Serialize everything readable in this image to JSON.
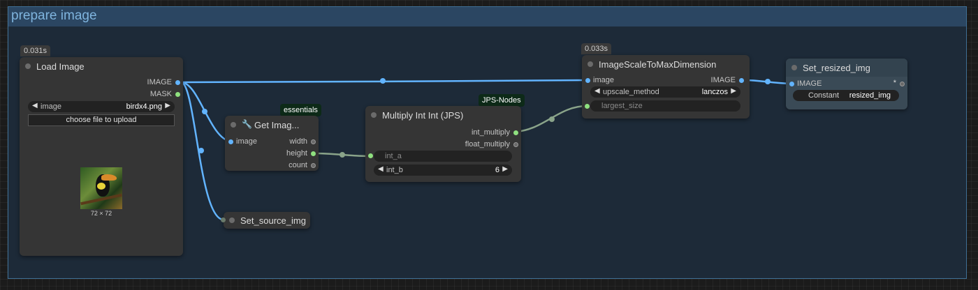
{
  "group": {
    "title": "prepare image"
  },
  "colors": {
    "image_link": "#62b4ff",
    "int_link": "#8aa48a",
    "group_header": "#2b4662"
  },
  "nodes": {
    "load_image": {
      "badge": "0.031s",
      "title": "Load Image",
      "outputs": [
        "IMAGE",
        "MASK"
      ],
      "image_widget": {
        "name": "image",
        "value": "birdx4.png"
      },
      "upload_label": "choose file to upload",
      "thumb_caption": "72 × 72"
    },
    "get_image_size": {
      "tag": "essentials",
      "icon": "wrench-icon",
      "title": "Get Imag...",
      "input": "image",
      "outputs": [
        "width",
        "height",
        "count"
      ]
    },
    "set_source_img": {
      "title": "Set_source_img"
    },
    "multiply_int": {
      "tag": "JPS-Nodes",
      "title": "Multiply Int Int (JPS)",
      "outputs": [
        "int_multiply",
        "float_multiply"
      ],
      "int_a": "int_a",
      "int_b": {
        "name": "int_b",
        "value": "6"
      }
    },
    "image_scale": {
      "badge": "0.033s",
      "title": "ImageScaleToMaxDimension",
      "input": "image",
      "output": "IMAGE",
      "upscale_method": {
        "name": "upscale_method",
        "value": "lanczos"
      },
      "largest_size": "largest_size"
    },
    "set_resized_img": {
      "title": "Set_resized_img",
      "input": "IMAGE",
      "output_marker": "*",
      "constant": {
        "name": "Constant",
        "value": "resized_img"
      }
    }
  }
}
